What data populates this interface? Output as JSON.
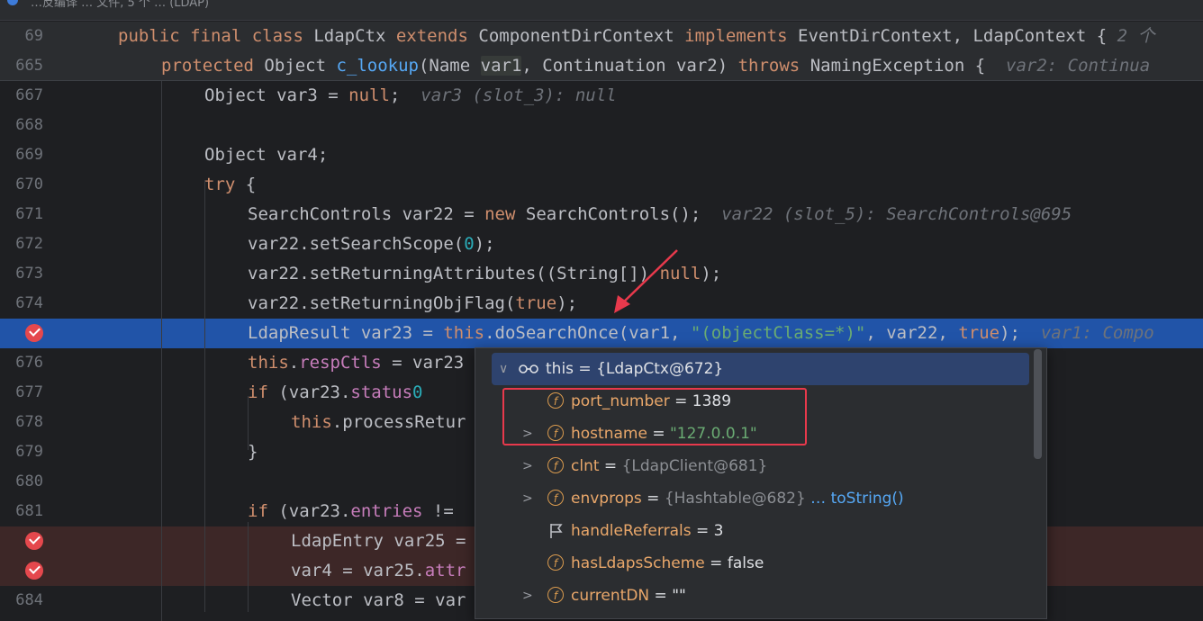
{
  "topbar": {
    "text": "…反编译 … 文件, 5 个 … (LDAP)"
  },
  "sticky": [
    {
      "ln": "69",
      "parts": [
        [
          "kw",
          "public final class "
        ],
        [
          "",
          "LdapCtx "
        ],
        [
          "kw",
          "extends "
        ],
        [
          "",
          "ComponentDirContext "
        ],
        [
          "kw",
          "implements "
        ],
        [
          "",
          "EventDirContext, LdapContext { "
        ],
        [
          "hint",
          "2 个"
        ]
      ]
    },
    {
      "ln": "665",
      "parts": [
        [
          "kw",
          "protected "
        ],
        [
          "",
          "Object "
        ],
        [
          "fn",
          "c_lookup"
        ],
        [
          "",
          "(Name "
        ],
        [
          "hlvar",
          "var1"
        ],
        [
          "",
          ", Continuation var2) "
        ],
        [
          "kw",
          "throws "
        ],
        [
          "",
          "NamingException {  "
        ],
        [
          "hint",
          "var2: Continua"
        ]
      ]
    }
  ],
  "lines": [
    {
      "ln": "667",
      "indent": 2,
      "parts": [
        [
          "",
          "Object var3 = "
        ],
        [
          "kw",
          "null"
        ],
        [
          "",
          ";  "
        ],
        [
          "hint",
          "var3 (slot_3): null"
        ]
      ]
    },
    {
      "ln": "668",
      "indent": 2,
      "parts": []
    },
    {
      "ln": "669",
      "indent": 2,
      "parts": [
        [
          "",
          "Object var4;"
        ]
      ]
    },
    {
      "ln": "670",
      "indent": 2,
      "parts": [
        [
          "kw",
          "try "
        ],
        [
          "",
          "{"
        ]
      ]
    },
    {
      "ln": "671",
      "indent": 3,
      "parts": [
        [
          "",
          "SearchControls var22 = "
        ],
        [
          "kw",
          "new "
        ],
        [
          "",
          "SearchControls();  "
        ],
        [
          "hint",
          "var22 (slot_5): SearchControls@695"
        ]
      ]
    },
    {
      "ln": "672",
      "indent": 3,
      "parts": [
        [
          "",
          "var22.setSearchScope("
        ],
        [
          "num",
          "0"
        ],
        [
          "",
          ");"
        ]
      ]
    },
    {
      "ln": "673",
      "indent": 3,
      "parts": [
        [
          "",
          "var22.setReturningAttributes((String[]) "
        ],
        [
          "kw",
          "null"
        ],
        [
          "",
          ");"
        ]
      ]
    },
    {
      "ln": "674",
      "indent": 3,
      "parts": [
        [
          "",
          "var22.setReturningObjFlag("
        ],
        [
          "kw",
          "true"
        ],
        [
          "",
          ");"
        ]
      ]
    },
    {
      "ln": "",
      "indent": 3,
      "exec": true,
      "bp": true,
      "parts": [
        [
          "",
          "LdapResult var23 = "
        ],
        [
          "kw",
          "this"
        ],
        [
          "",
          ".doSearchOnce(var1, "
        ],
        [
          "str",
          "\"(objectClass=*)\""
        ],
        [
          "",
          ", var22, "
        ],
        [
          "kw",
          "true"
        ],
        [
          "",
          ");  "
        ],
        [
          "hint",
          "var1: Compo"
        ]
      ]
    },
    {
      "ln": "676",
      "indent": 3,
      "parts": [
        [
          "kw",
          "this"
        ],
        [
          "",
          "."
        ],
        [
          "fld",
          "respCtls"
        ],
        [
          "",
          " = var23"
        ]
      ]
    },
    {
      "ln": "677",
      "indent": 3,
      "parts": [
        [
          "kw",
          "if "
        ],
        [
          "",
          "(var23."
        ],
        [
          "fld",
          "status"
        ],
        [
          "",
          "",
          " != "
        ],
        [
          "num",
          "0"
        ]
      ]
    },
    {
      "ln": "678",
      "indent": 4,
      "parts": [
        [
          "kw",
          "this"
        ],
        [
          "",
          ".processRetur"
        ]
      ]
    },
    {
      "ln": "679",
      "indent": 3,
      "parts": [
        [
          "",
          "}"
        ]
      ]
    },
    {
      "ln": "680",
      "indent": 3,
      "parts": []
    },
    {
      "ln": "681",
      "indent": 3,
      "parts": [
        [
          "kw",
          "if "
        ],
        [
          "",
          "(var23."
        ],
        [
          "fld",
          "entries"
        ],
        [
          "",
          " != "
        ]
      ]
    },
    {
      "ln": "",
      "indent": 4,
      "bpline": true,
      "bp": true,
      "parts": [
        [
          "",
          "LdapEntry var25 = "
        ]
      ]
    },
    {
      "ln": "",
      "indent": 4,
      "bpline": true,
      "bp": true,
      "parts": [
        [
          "",
          "var4 = var25."
        ],
        [
          "fld",
          "attr"
        ]
      ]
    },
    {
      "ln": "684",
      "indent": 4,
      "parts": [
        [
          "",
          "Vector var8 = var"
        ]
      ]
    }
  ],
  "popup": {
    "rows": [
      {
        "kind": "this",
        "chevron": "∨",
        "name": "this",
        "eq": " = ",
        "value": "{LdapCtx@672}",
        "vstyle": "val"
      },
      {
        "kind": "field",
        "chevron": "",
        "name": "port_number",
        "eq": " = ",
        "value": "1389",
        "vstyle": "val"
      },
      {
        "kind": "field",
        "chevron": ">",
        "name": "hostname",
        "eq": " = ",
        "value": "\"127.0.0.1\"",
        "vstyle": "str"
      },
      {
        "kind": "field",
        "chevron": ">",
        "name": "clnt",
        "eq": " = ",
        "value": "{LdapClient@681}",
        "vstyle": "gray"
      },
      {
        "kind": "field",
        "chevron": ">",
        "name": "envprops",
        "eq": " = ",
        "value": "{Hashtable@682}",
        "vstyle": "gray",
        "link": " … toString()"
      },
      {
        "kind": "flag",
        "chevron": "",
        "name": "handleReferrals",
        "eq": " = ",
        "value": "3",
        "vstyle": "val"
      },
      {
        "kind": "field",
        "chevron": "",
        "name": "hasLdapsScheme",
        "eq": " = ",
        "value": "false",
        "vstyle": "val"
      },
      {
        "kind": "field",
        "chevron": ">",
        "name": "currentDN",
        "eq": " = ",
        "value": "\"\"",
        "vstyle": "val"
      }
    ]
  },
  "icons": {
    "field": "field-f-icon",
    "flag": "flag-icon",
    "watch": "glasses-icon"
  },
  "colors": {
    "exec_line": "#2154a8",
    "breakpoint": "#e5484d",
    "highlight_box": "#e8394c"
  }
}
